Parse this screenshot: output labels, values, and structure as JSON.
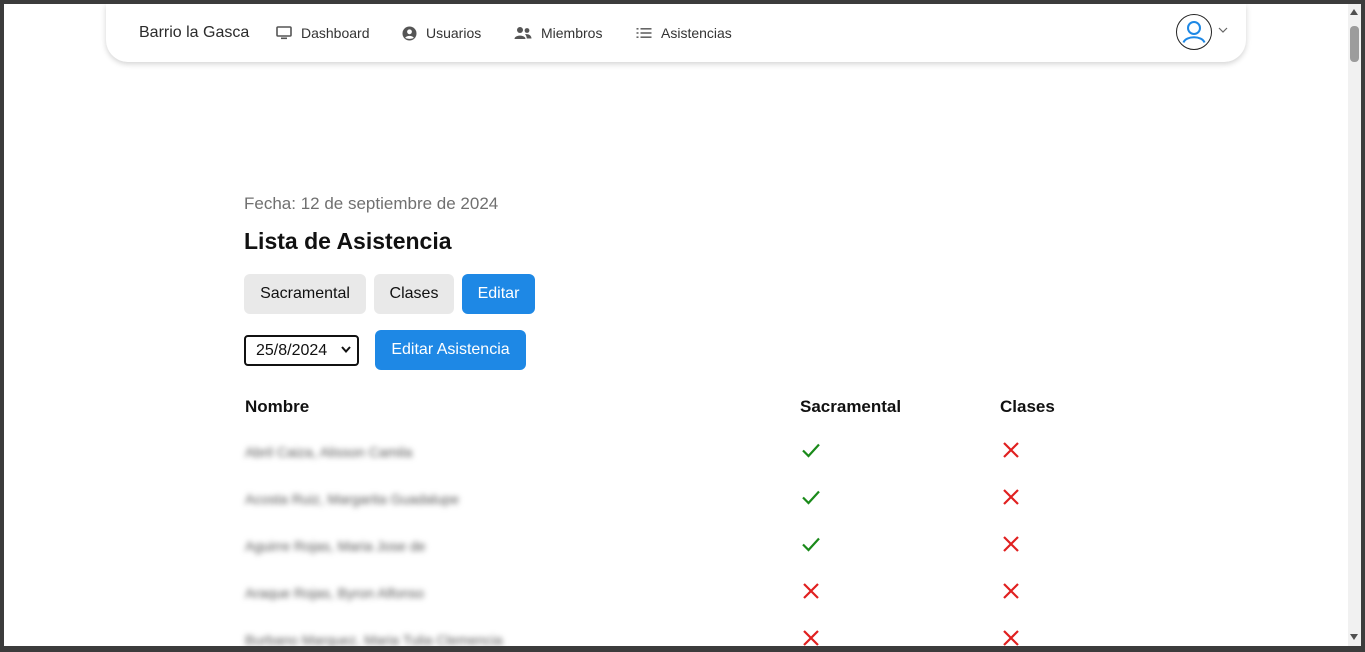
{
  "nav": {
    "brand": "Barrio la Gasca",
    "items": [
      {
        "label": "Dashboard",
        "icon": "monitor-icon"
      },
      {
        "label": "Usuarios",
        "icon": "user-circle-icon"
      },
      {
        "label": "Miembros",
        "icon": "users-icon"
      },
      {
        "label": "Asistencias",
        "icon": "list-icon"
      }
    ],
    "avatar_icon": "user-avatar-icon"
  },
  "header": {
    "fecha": "Fecha: 12 de septiembre de 2024",
    "title": "Lista de Asistencia"
  },
  "tabs": {
    "sacramental": "Sacramental",
    "clases": "Clases",
    "editar": "Editar"
  },
  "edit": {
    "selected_date": "25/8/2024",
    "button": "Editar Asistencia"
  },
  "table": {
    "headers": [
      "Nombre",
      "Sacramental",
      "Clases"
    ],
    "rows": [
      {
        "name": "Abril Caiza, Alisson Camila",
        "sacramental": true,
        "clases": false
      },
      {
        "name": "Acosta Ruiz, Margarita Guadalupe",
        "sacramental": true,
        "clases": false
      },
      {
        "name": "Aguirre Rojas, Maria Jose de",
        "sacramental": true,
        "clases": false
      },
      {
        "name": "Araque Rojas, Byron Alfonso",
        "sacramental": false,
        "clases": false
      },
      {
        "name": "Burbano Marquez, Maria Tulia Clemencia",
        "sacramental": false,
        "clases": false
      }
    ]
  },
  "colors": {
    "accent": "#1e88e5",
    "check": "#1a8a1a",
    "cross": "#e02020"
  }
}
